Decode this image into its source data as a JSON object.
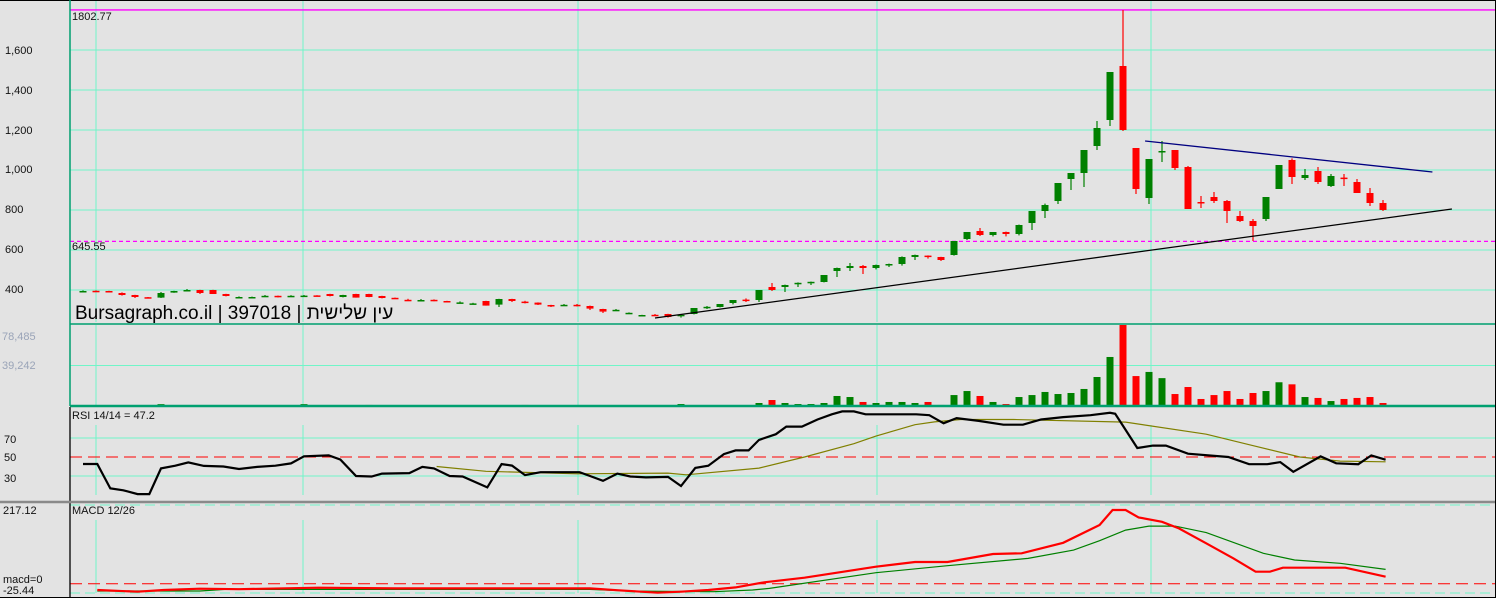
{
  "chart_data": {
    "type": "candlestick",
    "watermark": "Bursagraph.co.il | 397018 | עין שלישית",
    "price_axis": {
      "ticks": [
        "1,600",
        "1,400",
        "1,200",
        "1,000",
        "800",
        "600",
        "400"
      ],
      "tick_values": [
        1600,
        1400,
        1200,
        1000,
        800,
        600,
        400
      ]
    },
    "levels": [
      {
        "label": "1802.77",
        "value": 1802.77,
        "style": "solid",
        "color": "#ff00ff"
      },
      {
        "label": "645.55",
        "value": 645.55,
        "style": "dashed",
        "color": "#ff00ff"
      }
    ],
    "trendlines": [
      {
        "name": "resistance",
        "color": "#000080",
        "from": [
          81.7,
          1145
        ],
        "to": [
          103.8,
          990
        ]
      },
      {
        "name": "support",
        "color": "#000000",
        "from": [
          44,
          260
        ],
        "to": [
          105.3,
          805
        ]
      }
    ],
    "ohlc": [
      [
        394,
        398,
        390,
        395
      ],
      [
        396,
        398,
        390,
        395
      ],
      [
        395,
        396,
        392,
        393
      ],
      [
        385,
        388,
        372,
        375
      ],
      [
        375,
        376,
        360,
        365
      ],
      [
        364,
        365,
        362,
        362
      ],
      [
        362,
        390,
        360,
        385
      ],
      [
        387,
        396,
        386,
        395
      ],
      [
        399,
        405,
        396,
        400
      ],
      [
        400,
        401,
        380,
        385
      ],
      [
        400,
        401,
        380,
        380
      ],
      [
        380,
        381,
        368,
        370
      ],
      [
        364,
        368,
        360,
        365
      ],
      [
        364,
        367,
        362,
        365
      ],
      [
        369,
        375,
        366,
        371
      ],
      [
        371,
        372,
        363,
        370
      ],
      [
        369,
        374,
        366,
        371
      ],
      [
        370,
        375,
        365,
        372
      ],
      [
        373,
        374,
        368,
        372
      ],
      [
        380,
        381,
        368,
        370
      ],
      [
        365,
        376,
        363,
        375
      ],
      [
        380,
        381,
        362,
        362
      ],
      [
        380,
        381,
        364,
        365
      ],
      [
        370,
        371,
        358,
        360
      ],
      [
        361,
        362,
        359,
        360
      ],
      [
        351,
        356,
        345,
        350
      ],
      [
        349,
        355,
        347,
        350
      ],
      [
        351,
        353,
        344,
        350
      ],
      [
        345,
        346,
        338,
        340
      ],
      [
        337,
        343,
        334,
        338
      ],
      [
        332,
        336,
        330,
        333
      ],
      [
        345,
        346,
        322,
        322
      ],
      [
        327,
        356,
        315,
        355
      ],
      [
        355,
        356,
        340,
        345
      ],
      [
        342,
        346,
        333,
        335
      ],
      [
        337,
        338,
        325,
        327
      ],
      [
        325,
        326,
        315,
        320
      ],
      [
        324,
        330,
        322,
        326
      ],
      [
        326,
        330,
        318,
        324
      ],
      [
        320,
        322,
        300,
        307
      ],
      [
        305,
        306,
        285,
        292
      ],
      [
        299,
        305,
        297,
        301
      ],
      [
        284,
        288,
        282,
        286
      ],
      [
        274,
        276,
        272,
        275
      ],
      [
        276,
        280,
        272,
        274
      ],
      [
        280,
        281,
        262,
        265
      ],
      [
        274,
        277,
        262,
        276
      ],
      [
        280,
        310,
        278,
        310
      ],
      [
        314,
        320,
        305,
        316
      ],
      [
        315,
        330,
        313,
        330
      ],
      [
        335,
        350,
        328,
        350
      ],
      [
        352,
        358,
        340,
        350
      ],
      [
        350,
        400,
        340,
        400
      ],
      [
        415,
        435,
        395,
        400
      ],
      [
        415,
        427,
        390,
        425
      ],
      [
        433,
        438,
        415,
        436
      ],
      [
        438,
        442,
        425,
        441
      ],
      [
        440,
        475,
        438,
        475
      ],
      [
        495,
        512,
        465,
        510
      ],
      [
        510,
        535,
        495,
        520
      ],
      [
        520,
        525,
        480,
        510
      ],
      [
        510,
        527,
        503,
        525
      ],
      [
        528,
        532,
        515,
        530
      ],
      [
        530,
        568,
        522,
        565
      ],
      [
        565,
        577,
        550,
        575
      ],
      [
        572,
        573,
        557,
        568
      ],
      [
        565,
        566,
        545,
        550
      ],
      [
        575,
        645,
        572,
        645
      ],
      [
        655,
        690,
        650,
        690
      ],
      [
        695,
        710,
        670,
        675
      ],
      [
        675,
        690,
        668,
        690
      ],
      [
        690,
        692,
        668,
        680
      ],
      [
        680,
        727,
        673,
        725
      ],
      [
        735,
        795,
        700,
        795
      ],
      [
        795,
        832,
        760,
        825
      ],
      [
        845,
        935,
        830,
        935
      ],
      [
        955,
        985,
        900,
        985
      ],
      [
        985,
        1100,
        915,
        1100
      ],
      [
        1120,
        1245,
        1100,
        1210
      ],
      [
        1250,
        1490,
        1220,
        1490
      ],
      [
        1520,
        1802.77,
        1195,
        1200
      ],
      [
        1110,
        1110,
        880,
        905
      ],
      [
        860,
        1055,
        830,
        1055
      ],
      [
        1090,
        1145,
        1040,
        1095
      ],
      [
        1100,
        1100,
        1000,
        1010
      ],
      [
        1015,
        1020,
        805,
        805
      ],
      [
        840,
        870,
        810,
        838
      ],
      [
        865,
        890,
        835,
        845
      ],
      [
        845,
        850,
        735,
        795
      ],
      [
        770,
        795,
        740,
        745
      ],
      [
        745,
        755,
        645,
        720
      ],
      [
        755,
        865,
        745,
        865
      ],
      [
        905,
        1025,
        905,
        1025
      ],
      [
        1050,
        1058,
        930,
        965
      ],
      [
        960,
        1005,
        950,
        975
      ],
      [
        995,
        1015,
        930,
        940
      ],
      [
        920,
        980,
        915,
        970
      ],
      [
        962,
        980,
        920,
        958
      ],
      [
        940,
        955,
        885,
        885
      ],
      [
        885,
        910,
        820,
        835
      ],
      [
        835,
        850,
        795,
        800
      ]
    ],
    "volume": {
      "ticks": [
        "78,485",
        "39,242"
      ],
      "tick_values": [
        78485,
        39242
      ],
      "values": [
        200,
        300,
        200,
        300,
        200,
        400,
        1800,
        300,
        200,
        300,
        400,
        300,
        200,
        300,
        200,
        300,
        200,
        1800,
        300,
        200,
        300,
        400,
        1000,
        300,
        200,
        300,
        200,
        300,
        200,
        300,
        400,
        300,
        200,
        300,
        1000,
        800,
        300,
        400,
        300,
        900,
        900,
        300,
        900,
        900,
        300,
        900,
        1900,
        900,
        900,
        900,
        900,
        900,
        2900,
        5800,
        2900,
        1900,
        1900,
        2900,
        9700,
        8700,
        3900,
        2900,
        3900,
        3900,
        2900,
        3900,
        1000,
        10600,
        14500,
        9700,
        3900,
        1900,
        8700,
        10600,
        13600,
        11600,
        12600,
        16500,
        28100,
        47500,
        78485,
        29000,
        33000,
        27000,
        11600,
        18400,
        6800,
        10600,
        14500,
        6800,
        12600,
        14500,
        23000,
        21000,
        8700,
        7800,
        4800,
        6800,
        7800,
        8700,
        2900
      ]
    },
    "rsi": {
      "title": "RSI 14/14 = 47.2",
      "ticks": [
        "70",
        "50",
        "30"
      ],
      "tick_values": [
        70,
        50,
        30
      ],
      "line": [
        [
          0,
          42.6
        ],
        [
          1.1,
          42.6
        ],
        [
          2.1,
          17
        ],
        [
          3.1,
          15
        ],
        [
          4.2,
          11
        ],
        [
          5.1,
          11
        ],
        [
          6,
          38
        ],
        [
          7.1,
          40.8
        ],
        [
          8.1,
          44.3
        ],
        [
          9.3,
          40.6
        ],
        [
          10.8,
          40
        ],
        [
          12,
          37.4
        ],
        [
          13.4,
          39.6
        ],
        [
          14.8,
          40.8
        ],
        [
          16,
          43.3
        ],
        [
          17,
          50.7
        ],
        [
          18.9,
          51.7
        ],
        [
          19.8,
          47.3
        ],
        [
          21,
          30
        ],
        [
          22.2,
          29.5
        ],
        [
          23,
          32.5
        ],
        [
          25.1,
          33
        ],
        [
          26.1,
          39.6
        ],
        [
          27,
          38
        ],
        [
          28.2,
          30
        ],
        [
          29.2,
          29.5
        ],
        [
          31.1,
          18
        ],
        [
          32.2,
          42.5
        ],
        [
          33,
          41
        ],
        [
          34,
          31
        ],
        [
          35.2,
          34
        ],
        [
          38.2,
          34
        ],
        [
          39,
          30
        ],
        [
          40,
          25
        ],
        [
          41.1,
          32.5
        ],
        [
          42.1,
          29.5
        ],
        [
          43.3,
          28.5
        ],
        [
          45,
          29.1
        ],
        [
          46,
          19.5
        ],
        [
          47.1,
          38.5
        ],
        [
          48.1,
          40.8
        ],
        [
          49.3,
          53
        ],
        [
          50.2,
          57
        ],
        [
          51.2,
          57
        ],
        [
          52,
          68
        ],
        [
          53.3,
          74
        ],
        [
          54.1,
          82
        ],
        [
          55.3,
          82
        ],
        [
          56.5,
          89.5
        ],
        [
          57.6,
          95
        ],
        [
          58.4,
          98
        ],
        [
          59.3,
          98
        ],
        [
          60.2,
          95
        ],
        [
          64.1,
          95
        ],
        [
          65.1,
          94
        ],
        [
          66.2,
          85.5
        ],
        [
          67.2,
          91
        ],
        [
          68.9,
          88
        ],
        [
          70.8,
          84
        ],
        [
          72.3,
          84
        ],
        [
          73.7,
          89.5
        ],
        [
          75.4,
          92
        ],
        [
          77.5,
          94
        ],
        [
          79,
          96.5
        ],
        [
          79.4,
          95.5
        ],
        [
          80.2,
          78.5
        ],
        [
          81.1,
          59.5
        ],
        [
          82.3,
          62
        ],
        [
          83.3,
          62
        ],
        [
          85,
          53.5
        ],
        [
          88.1,
          50
        ],
        [
          89.7,
          42.4
        ],
        [
          91.1,
          42.4
        ],
        [
          92.1,
          44.6
        ],
        [
          93.1,
          34.4
        ],
        [
          95.2,
          50.6
        ],
        [
          96.4,
          43.4
        ],
        [
          98.1,
          42.4
        ],
        [
          99.1,
          51.7
        ],
        [
          100.2,
          47.2
        ]
      ],
      "signal": [
        [
          27.2,
          40
        ],
        [
          31,
          35
        ],
        [
          38,
          32.3
        ],
        [
          45,
          33
        ],
        [
          46.4,
          31.3
        ],
        [
          52,
          38.3
        ],
        [
          55.5,
          50
        ],
        [
          59.3,
          64
        ],
        [
          61,
          72
        ],
        [
          64,
          84
        ],
        [
          65.5,
          87
        ],
        [
          67.5,
          89.5
        ],
        [
          71.6,
          89.5
        ],
        [
          80.2,
          86.7
        ],
        [
          86.4,
          74
        ],
        [
          89.9,
          62.3
        ],
        [
          93.6,
          50
        ],
        [
          96.7,
          45.7
        ],
        [
          100.2,
          45
        ]
      ]
    },
    "macd": {
      "title": "MACD 12/26",
      "ticks": [
        "217.12",
        "macd=0",
        "-25.44"
      ],
      "range": [
        -25.44,
        217.12
      ],
      "macd_line": [
        [
          1.1,
          -17
        ],
        [
          4.2,
          -21.7
        ],
        [
          6.2,
          -17
        ],
        [
          9,
          -13.5
        ],
        [
          12,
          -15
        ],
        [
          14.1,
          -13.5
        ],
        [
          18.1,
          -10.7
        ],
        [
          24.1,
          -12.6
        ],
        [
          39,
          -12.6
        ],
        [
          41.2,
          -18
        ],
        [
          44.2,
          -24.5
        ],
        [
          46,
          -21.7
        ],
        [
          48.1,
          -17
        ],
        [
          50.2,
          -9.8
        ],
        [
          52.4,
          4
        ],
        [
          55.5,
          16.8
        ],
        [
          59,
          36
        ],
        [
          61,
          47
        ],
        [
          64,
          60
        ],
        [
          66.5,
          60
        ],
        [
          70,
          82
        ],
        [
          72.2,
          84
        ],
        [
          75.4,
          113
        ],
        [
          78.2,
          162
        ],
        [
          79.2,
          203.3
        ],
        [
          80.2,
          203.3
        ],
        [
          81.2,
          183
        ],
        [
          83,
          171
        ],
        [
          84.3,
          152.8
        ],
        [
          86.4,
          111.5
        ],
        [
          88.5,
          70
        ],
        [
          90.2,
          33.4
        ],
        [
          91.3,
          33.4
        ],
        [
          92.3,
          44.4
        ],
        [
          97.1,
          44.4
        ],
        [
          100.2,
          19.6
        ]
      ],
      "signal_line": [
        [
          1.1,
          -19.9
        ],
        [
          9,
          -19.9
        ],
        [
          10.9,
          -15.3
        ],
        [
          18.2,
          -15.3
        ],
        [
          39,
          -15.3
        ],
        [
          42,
          -19.9
        ],
        [
          48.5,
          -21.7
        ],
        [
          51.5,
          -17
        ],
        [
          52.8,
          -12.6
        ],
        [
          61,
          30.6
        ],
        [
          66.5,
          50
        ],
        [
          72.7,
          70
        ],
        [
          76.2,
          93
        ],
        [
          78.2,
          118.8
        ],
        [
          80.2,
          148
        ],
        [
          82,
          159
        ],
        [
          84,
          159
        ],
        [
          86.4,
          141
        ],
        [
          90.8,
          84
        ],
        [
          93.2,
          65.5
        ],
        [
          96.7,
          56.4
        ],
        [
          100.2,
          39.8
        ]
      ]
    },
    "colors": {
      "up": "#008000",
      "down": "#ff0000",
      "grid": "#70f5c8",
      "rsi": "#000000",
      "rsi_signal": "#808000",
      "macd": "#ff0000",
      "macd_signal": "#008000"
    }
  }
}
